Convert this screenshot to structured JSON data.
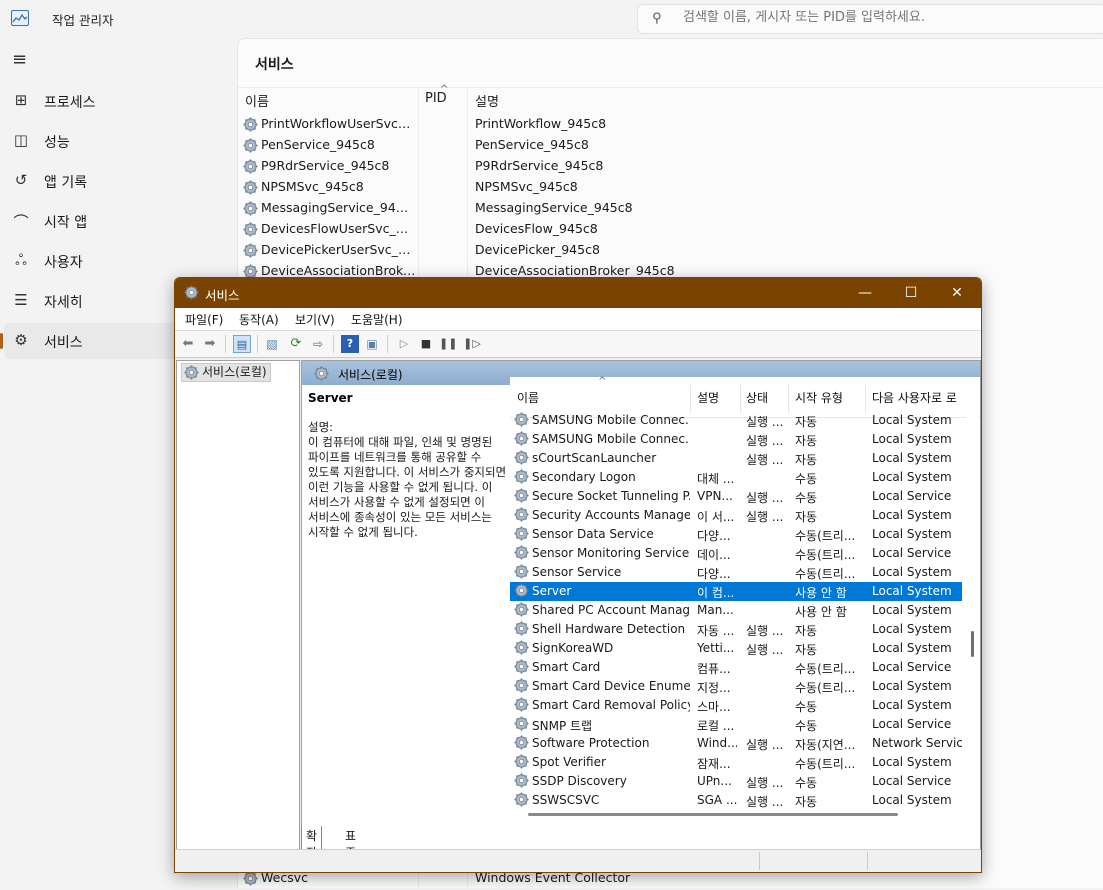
{
  "taskmanager": {
    "title": "작업 관리자",
    "search_placeholder": "검색할 이름, 게시자 또는 PID를 입력하세요.",
    "nav": [
      {
        "label": "프로세스",
        "icon": "processes-icon"
      },
      {
        "label": "성능",
        "icon": "performance-icon"
      },
      {
        "label": "앱 기록",
        "icon": "app-history-icon"
      },
      {
        "label": "시작 앱",
        "icon": "startup-apps-icon"
      },
      {
        "label": "사용자",
        "icon": "users-icon"
      },
      {
        "label": "자세히",
        "icon": "details-icon"
      },
      {
        "label": "서비스",
        "icon": "services-icon"
      }
    ],
    "active_nav": "서비스",
    "page_title": "서비스",
    "columns": {
      "name": "이름",
      "pid": "PID",
      "desc": "설명"
    },
    "rows": [
      {
        "name": "PrintWorkflowUserSvc_9...",
        "desc": "PrintWorkflow_945c8"
      },
      {
        "name": "PenService_945c8",
        "desc": "PenService_945c8"
      },
      {
        "name": "P9RdrService_945c8",
        "desc": "P9RdrService_945c8"
      },
      {
        "name": "NPSMSvc_945c8",
        "desc": "NPSMSvc_945c8"
      },
      {
        "name": "MessagingService_945c8",
        "desc": "MessagingService_945c8"
      },
      {
        "name": "DevicesFlowUserSvc_945...",
        "desc": "DevicesFlow_945c8"
      },
      {
        "name": "DevicePickerUserSvc_94...",
        "desc": "DevicePicker_945c8"
      },
      {
        "name": "DeviceAssociationBroke...",
        "desc": "DeviceAssociationBroker_945c8"
      }
    ],
    "bottom_row": {
      "name": "Wecsvc",
      "desc": "Windows Event Collector"
    }
  },
  "services_window": {
    "title": "서비스",
    "controls": {
      "minimize": "—",
      "maximize": "☐",
      "close": "✕"
    },
    "menu": [
      "파일(F)",
      "동작(A)",
      "보기(V)",
      "도움말(H)"
    ],
    "tree_item": "서비스(로컬)",
    "right_header": "서비스(로컬)",
    "selected": {
      "name": "Server",
      "desc_label": "설명:",
      "desc": "이 컴퓨터에 대해 파일, 인쇄 및 명명된 파이프를 네트워크를 통해 공유할 수 있도록 지원합니다. 이 서비스가 중지되면 이런 기능을 사용할 수 없게 됩니다. 이 서비스가 사용할 수 없게 설정되면 이 서비스에 종속성이 있는 모든 서비스는 시작할 수 없게 됩니다."
    },
    "columns": {
      "name": "이름",
      "desc": "설명",
      "status": "상태",
      "startup": "시작 유형",
      "logon": "다음 사용자로 로"
    },
    "rows": [
      {
        "name": "SAMSUNG Mobile Connec...",
        "desc": "",
        "status": "실행 ...",
        "startup": "자동",
        "logon": "Local System"
      },
      {
        "name": "SAMSUNG Mobile Connec...",
        "desc": "",
        "status": "실행 ...",
        "startup": "자동",
        "logon": "Local System"
      },
      {
        "name": "sCourtScanLauncher",
        "desc": "",
        "status": "실행 ...",
        "startup": "자동",
        "logon": "Local System"
      },
      {
        "name": "Secondary Logon",
        "desc": "대체 ...",
        "status": "",
        "startup": "수동",
        "logon": "Local System"
      },
      {
        "name": "Secure Socket Tunneling P...",
        "desc": "VPN...",
        "status": "실행 ...",
        "startup": "수동",
        "logon": "Local Service"
      },
      {
        "name": "Security Accounts Manager",
        "desc": "이 서...",
        "status": "실행 ...",
        "startup": "자동",
        "logon": "Local System"
      },
      {
        "name": "Sensor Data Service",
        "desc": "다양...",
        "status": "",
        "startup": "수동(트리...",
        "logon": "Local System"
      },
      {
        "name": "Sensor Monitoring Service",
        "desc": "데이...",
        "status": "",
        "startup": "수동(트리...",
        "logon": "Local Service"
      },
      {
        "name": "Sensor Service",
        "desc": "다양...",
        "status": "",
        "startup": "수동(트리...",
        "logon": "Local System"
      },
      {
        "name": "Server",
        "desc": "이 컴...",
        "status": "",
        "startup": "사용 안 함",
        "logon": "Local System"
      },
      {
        "name": "Shared PC Account Manager",
        "desc": "Man...",
        "status": "",
        "startup": "사용 안 함",
        "logon": "Local System"
      },
      {
        "name": "Shell Hardware Detection",
        "desc": "자동 ...",
        "status": "실행 ...",
        "startup": "자동",
        "logon": "Local System"
      },
      {
        "name": "SignKoreaWD",
        "desc": "Yetti...",
        "status": "실행 ...",
        "startup": "자동",
        "logon": "Local System"
      },
      {
        "name": "Smart Card",
        "desc": "컴퓨...",
        "status": "",
        "startup": "수동(트리...",
        "logon": "Local Service"
      },
      {
        "name": "Smart Card Device Enumer...",
        "desc": "지정...",
        "status": "",
        "startup": "수동(트리...",
        "logon": "Local System"
      },
      {
        "name": "Smart Card Removal Policy",
        "desc": "스마...",
        "status": "",
        "startup": "수동",
        "logon": "Local System"
      },
      {
        "name": "SNMP 트랩",
        "desc": "로컬 ...",
        "status": "",
        "startup": "수동",
        "logon": "Local Service"
      },
      {
        "name": "Software Protection",
        "desc": "Wind...",
        "status": "실행 ...",
        "startup": "자동(지연...",
        "logon": "Network Service"
      },
      {
        "name": "Spot Verifier",
        "desc": "잠재...",
        "status": "",
        "startup": "수동(트리...",
        "logon": "Local System"
      },
      {
        "name": "SSDP Discovery",
        "desc": "UPn...",
        "status": "실행 ...",
        "startup": "수동",
        "logon": "Local Service"
      },
      {
        "name": "SSWSCSVC",
        "desc": "SGA ...",
        "status": "실행 ...",
        "startup": "자동",
        "logon": "Local System"
      }
    ],
    "selected_index": 9,
    "tabs": [
      "확장",
      "표준"
    ]
  },
  "colors": {
    "titlebar": "#7a4300",
    "selection": "#0078d7",
    "accent": "#b0601a"
  }
}
